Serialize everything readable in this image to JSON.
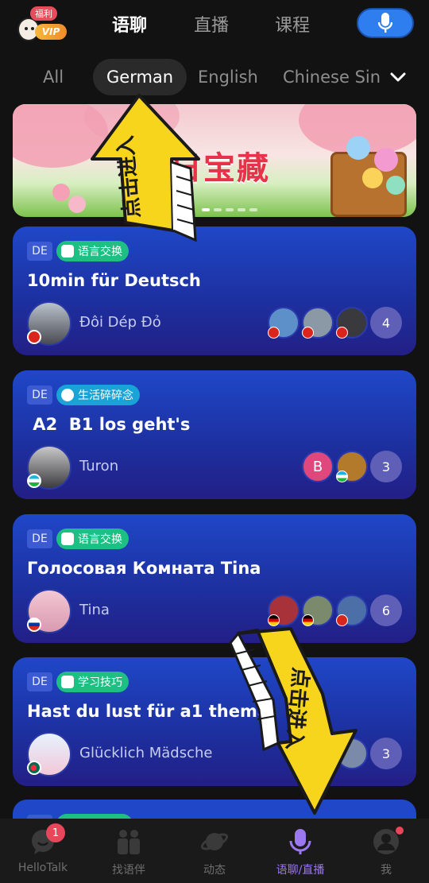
{
  "header": {
    "vip_bubble": "福利",
    "vip_label": "VIP",
    "tabs": [
      {
        "label": "语聊",
        "active": true
      },
      {
        "label": "直播",
        "active": false
      },
      {
        "label": "课程",
        "active": false
      }
    ],
    "mic_icon": "mic-icon"
  },
  "languages": {
    "items": [
      "All",
      "German",
      "English",
      "Chinese Sin"
    ],
    "selected": "German",
    "expand_icon": "chevron-down-icon"
  },
  "banner": {
    "title": "日宝藏",
    "page_count": 5,
    "active_page": 1
  },
  "overlay": {
    "arrow_text": "点击进入"
  },
  "rooms": [
    {
      "lang_code": "DE",
      "tag": "语言交换",
      "tag_style": "green",
      "title": "10min für Deutsch",
      "host": "Đôi Dép Đỏ",
      "host_flag": "vietnam",
      "member_flags": [
        "vietnam",
        "vietnam",
        "vietnam"
      ],
      "member_count": "4"
    },
    {
      "lang_code": "DE",
      "tag": "生活碎碎念",
      "tag_style": "blue",
      "title": " A2  B1 los geht's",
      "host": "Turon",
      "host_flag": "uzbekistan",
      "member_flags": [
        "uzbekistan",
        "uzbekistan"
      ],
      "member_initial": "B",
      "member_count": "3"
    },
    {
      "lang_code": "DE",
      "tag": "语言交换",
      "tag_style": "green",
      "title": "Голосовая Комната Tina",
      "host": "Tina",
      "host_flag": "russia",
      "member_flags": [
        "germany",
        "germany",
        "vietnam"
      ],
      "member_count": "6"
    },
    {
      "lang_code": "DE",
      "tag": "学习技巧",
      "tag_style": "green",
      "title": "Hast du lust für a1 thema",
      "host": "Glücklich Mädsche",
      "host_flag": "bangladesh",
      "member_flags": [],
      "member_count": "3"
    }
  ],
  "colors": {
    "accent": "#2f7ef0",
    "card_top": "#1f47c8",
    "card_bottom": "#231f86",
    "tag_green": "#1ebf83",
    "tag_blue": "#19a3d6",
    "nav_active": "#9b78f0",
    "badge": "#e8465a",
    "arrow_yellow": "#f7d51d"
  },
  "bottom_nav": [
    {
      "label": "HelloTalk",
      "icon": "chat-bubble-icon",
      "badge": "1"
    },
    {
      "label": "找语伴",
      "icon": "people-icon"
    },
    {
      "label": "动态",
      "icon": "planet-icon"
    },
    {
      "label": "语聊/直播",
      "icon": "mic-icon",
      "active": true
    },
    {
      "label": "我",
      "icon": "profile-icon",
      "dot": true
    }
  ]
}
